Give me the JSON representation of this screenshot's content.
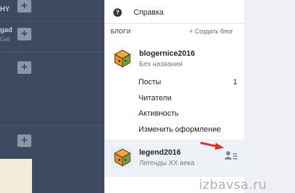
{
  "sidebar_fragments": {
    "row1_text": "HY",
    "row2_text": "gad",
    "row2_sub": "Gal"
  },
  "menu": {
    "help_label": "Справка",
    "blogs_section_title": "БЛОГИ",
    "create_blog_label": "+ Создать блог",
    "blogs": [
      {
        "name": "blogernice2016",
        "subtitle": "Без названия",
        "items": [
          {
            "label": "Посты",
            "count": "1"
          },
          {
            "label": "Читатели"
          },
          {
            "label": "Активность"
          },
          {
            "label": "Изменить оформление"
          }
        ]
      },
      {
        "name": "legend2016",
        "subtitle": "Легенды ХХ века"
      }
    ]
  },
  "watermark": "izbavsa.ru",
  "icons": {
    "help": "question-circle-icon",
    "add": "plus-icon",
    "blog_avatar": "cube-avatar-icon",
    "manage": "person-manage-icon",
    "arrow": "red-arrow-icon"
  },
  "colors": {
    "sidebar": "#3d4a62",
    "plus_button": "#8d96a8",
    "menu_bg": "#ffffff",
    "selected_bg": "#eef1f6",
    "cube_orange": "#e6932b",
    "cube_green": "#7aa23a",
    "arrow_red": "#e0301e"
  }
}
